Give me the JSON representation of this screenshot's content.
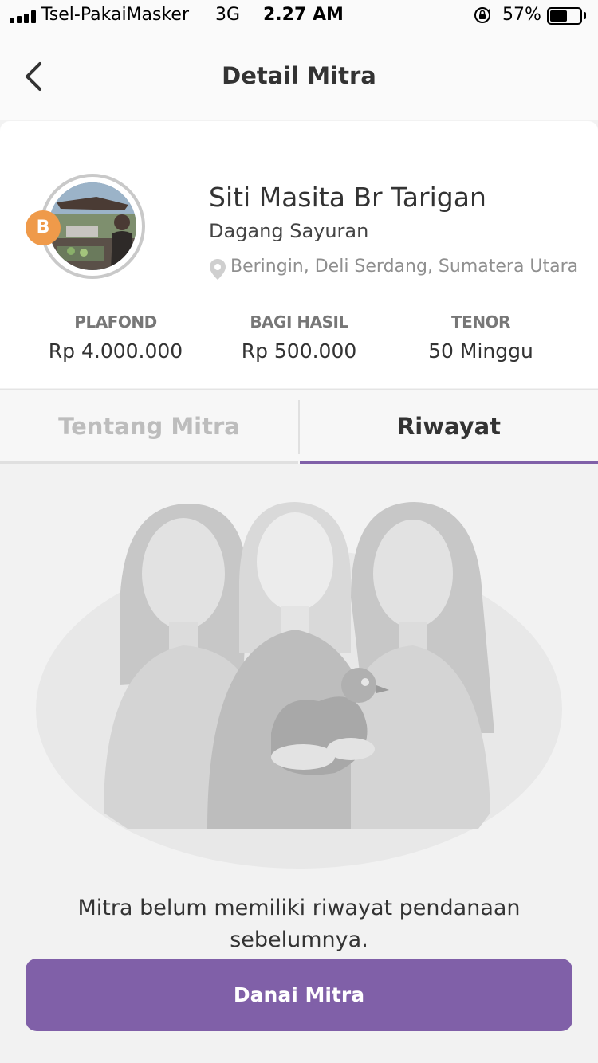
{
  "status_bar": {
    "carrier": "Tsel-PakaiMasker",
    "network": "3G",
    "time": "2.27 AM",
    "battery": "57%",
    "battery_level": 0.57
  },
  "header": {
    "title": "Detail Mitra",
    "back_icon": "chevron-left-icon"
  },
  "partner": {
    "badge": "B",
    "name": "Siti Masita Br Tarigan",
    "business": "Dagang Sayuran",
    "location": "Beringin, Deli Serdang, Sumatera Utara",
    "stats": [
      {
        "label": "PLAFOND",
        "value": "Rp 4.000.000"
      },
      {
        "label": "BAGI HASIL",
        "value": "Rp 500.000"
      },
      {
        "label": "TENOR",
        "value": "50 Minggu"
      }
    ]
  },
  "tabs": [
    {
      "label": "Tentang Mitra",
      "active": false
    },
    {
      "label": "Riwayat",
      "active": true
    }
  ],
  "empty_state": {
    "message": "Mitra belum memiliki riwayat pendanaan sebelumnya."
  },
  "cta": {
    "label": "Danai Mitra"
  },
  "colors": {
    "primary": "#8060a8",
    "badge": "#ef9a4a"
  }
}
